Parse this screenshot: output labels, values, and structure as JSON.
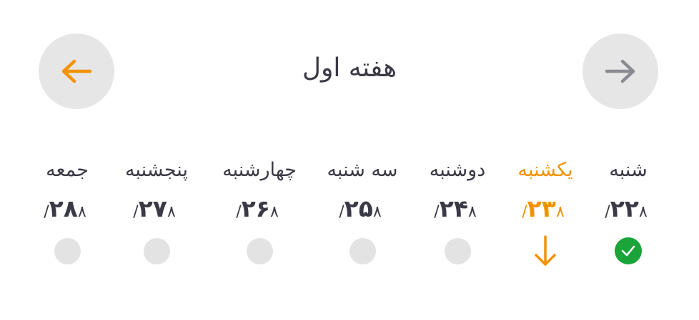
{
  "header": {
    "title": "هفته اول",
    "prev_icon": "arrow-left-icon",
    "next_icon": "arrow-right-icon"
  },
  "colors": {
    "accent": "#f39200",
    "done": "#1aa43a",
    "inactive": "#e3e3e3",
    "text": "#3a3a46",
    "nav_bg": "#e6e6e6"
  },
  "days": [
    {
      "name": "شنبه",
      "day": "۲۲",
      "month": "۸/",
      "status": "done"
    },
    {
      "name": "یکشنبه",
      "day": "۲۳",
      "month": "۸/",
      "status": "current"
    },
    {
      "name": "دوشنبه",
      "day": "۲۴",
      "month": "۸/",
      "status": "pending"
    },
    {
      "name": "سه شنبه",
      "day": "۲۵",
      "month": "۸/",
      "status": "pending"
    },
    {
      "name": "چهارشنبه",
      "day": "۲۶",
      "month": "۸/",
      "status": "pending"
    },
    {
      "name": "پنجشنبه",
      "day": "۲۷",
      "month": "۸/",
      "status": "pending"
    },
    {
      "name": "جمعه",
      "day": "۲۸",
      "month": "۸/",
      "status": "pending"
    }
  ]
}
